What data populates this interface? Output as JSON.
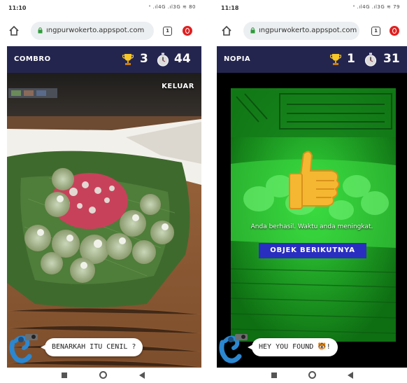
{
  "screens": [
    {
      "status": {
        "time": "11:10",
        "signal": "ᐤ .ıl4G .ıl3G ≋ 80"
      },
      "browser": {
        "url": "ıngpurwokerto.appspot.com",
        "tab_count": "1"
      },
      "game": {
        "object_name": "COMBRO",
        "score": "3",
        "time_left": "44",
        "exit_label": "KELUAR",
        "bubble_text": "BENARKAH ITU CENIL ?"
      }
    },
    {
      "status": {
        "time": "11:18",
        "signal": "ᐤ .ıl4G .ıl3G ≋ 79"
      },
      "browser": {
        "url": "ıngpurwokerto.appspot.com",
        "tab_count": "1"
      },
      "game": {
        "object_name": "NOPIA",
        "score": "1",
        "time_left": "31",
        "success_text": "Anda berhasil. Waktu anda meningkat.",
        "next_label": "OBJEK BERIKUTNYA",
        "bubble_text": "HEY YOU FOUND 🐯!"
      }
    }
  ],
  "colors": {
    "header_bg": "#24254f",
    "button_blue": "#2a2ec0",
    "camera_green": "#1fbf2a",
    "chrome_red": "#e02020"
  }
}
